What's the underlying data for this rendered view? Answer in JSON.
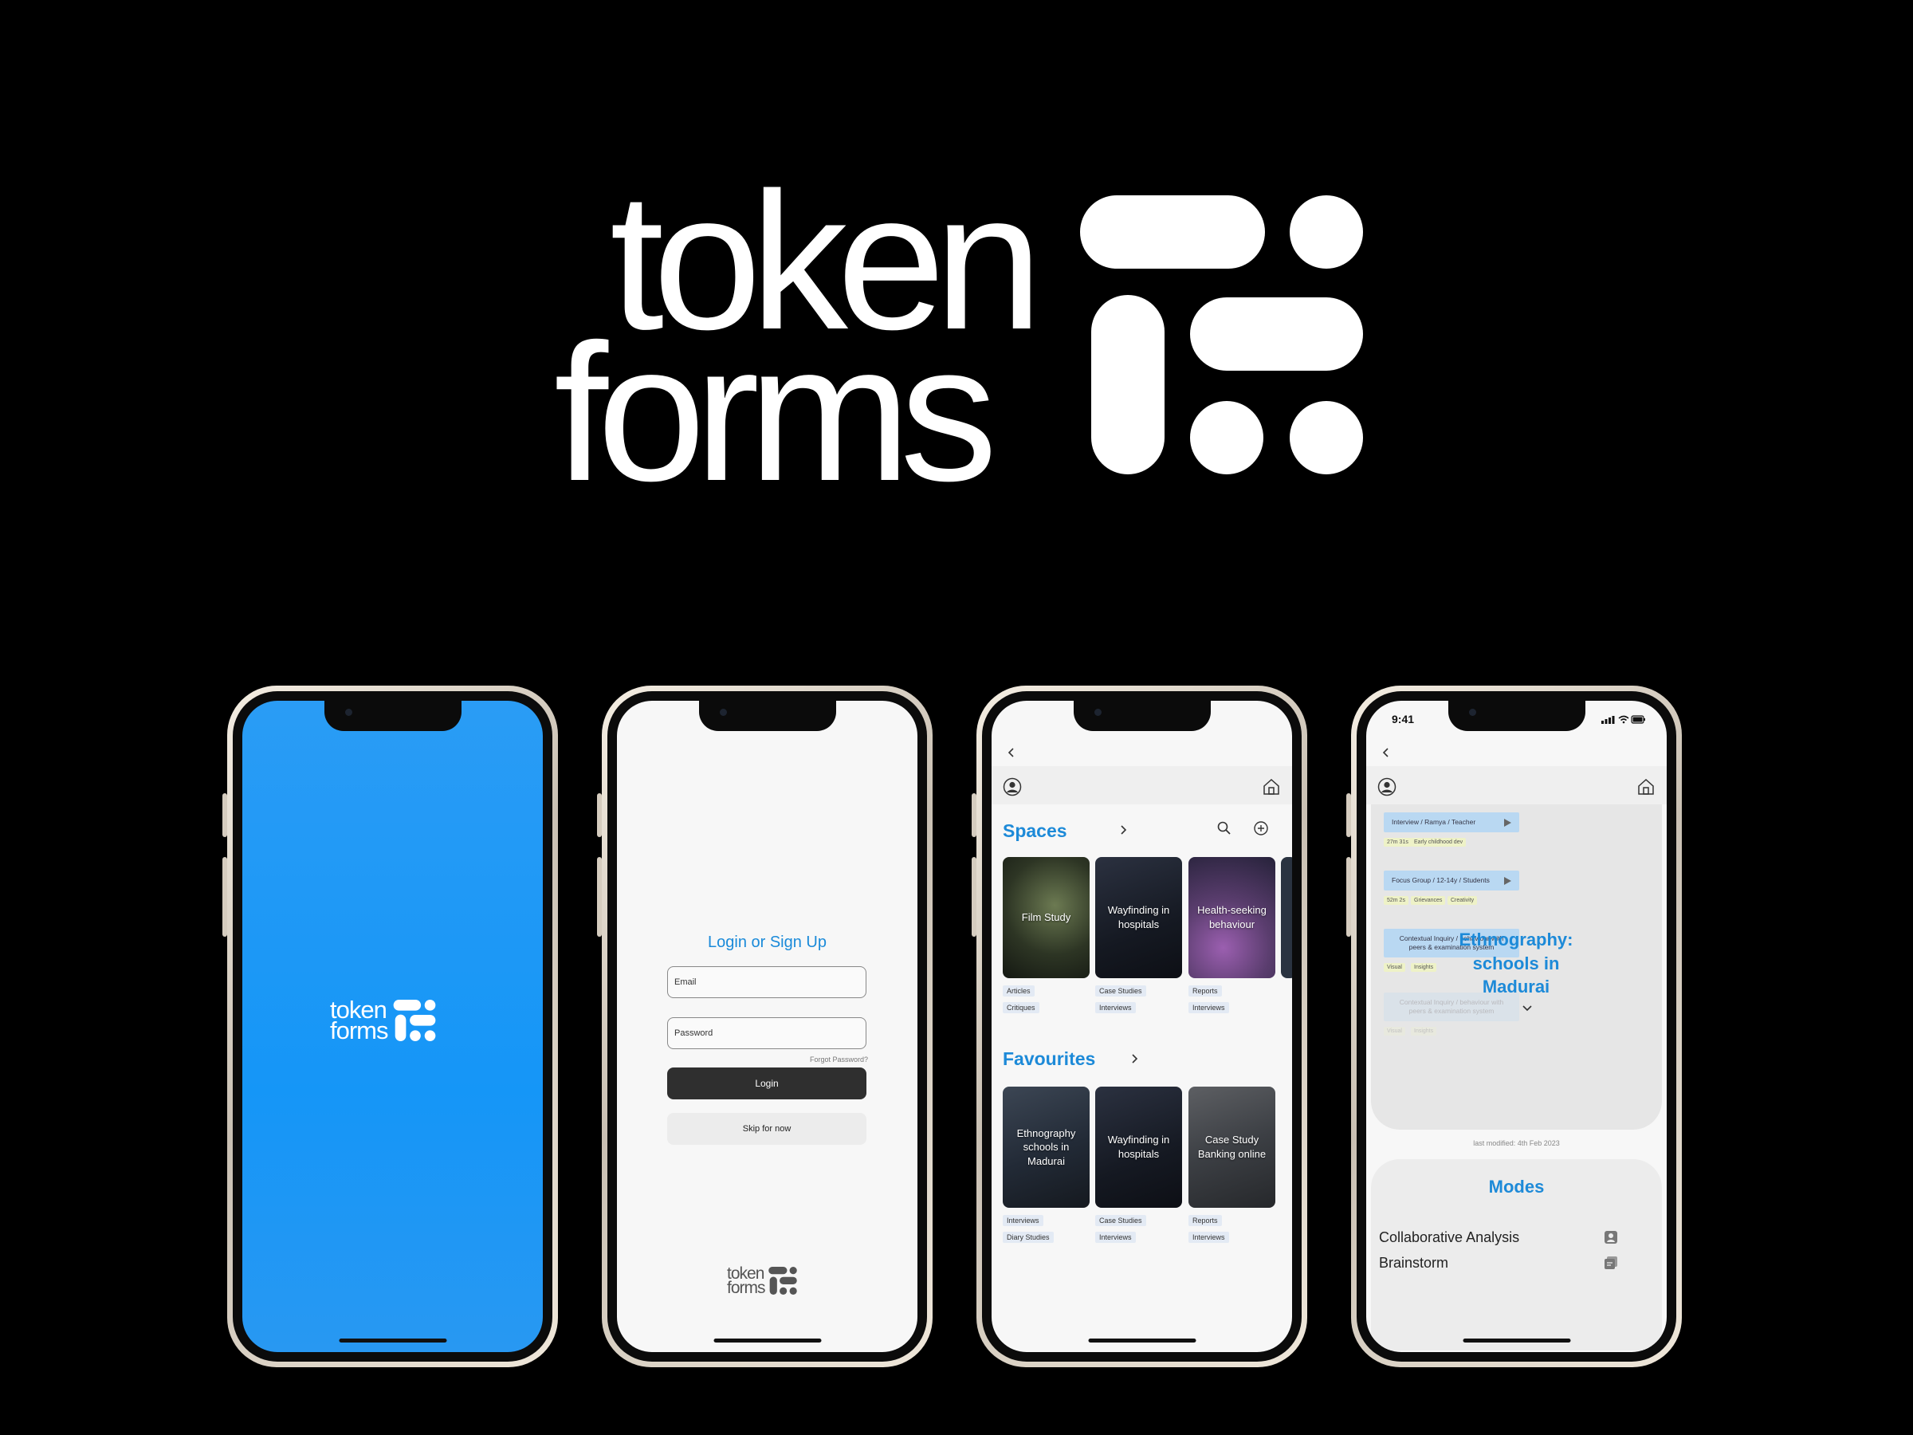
{
  "brand": {
    "word_top": "token",
    "word_bottom": "forms"
  },
  "login": {
    "title": "Login or Sign Up",
    "email_placeholder": "Email",
    "password_placeholder": "Password",
    "forgot": "Forgot Password?",
    "login_label": "Login",
    "skip_label": "Skip for now"
  },
  "spaces": {
    "title": "Spaces",
    "cards": [
      {
        "title": "Film Study",
        "tags": [
          "Articles",
          "Critiques"
        ]
      },
      {
        "title": "Wayfinding in hospitals",
        "tags": [
          "Case Studies",
          "Interviews"
        ]
      },
      {
        "title": "Health-seeking behaviour",
        "tags": [
          "Reports",
          "Interviews"
        ]
      }
    ]
  },
  "favourites": {
    "title": "Favourites",
    "cards": [
      {
        "title": "Ethnography schools in Madurai",
        "tags": [
          "Interviews",
          "Diary Studies"
        ]
      },
      {
        "title": "Wayfinding in hospitals",
        "tags": [
          "Case Studies",
          "Interviews"
        ]
      },
      {
        "title": "Case Study Banking online",
        "tags": [
          "Reports",
          "Interviews"
        ]
      }
    ]
  },
  "detail": {
    "status_time": "9:41",
    "recordings": [
      {
        "label": "Interview / Ramya / Teacher",
        "tags": [
          "27m 31s",
          "Early childhood dev"
        ]
      },
      {
        "label": "Focus Group / 12-14y / Students",
        "tags": [
          "52m 2s",
          "Grievances",
          "Creativity"
        ]
      },
      {
        "label": "Contextual Inquiry / behaviour with peers & examination system",
        "tags": [
          "Visual",
          "Insights"
        ]
      },
      {
        "label": "Contextual Inquiry / behaviour with peers & examination system",
        "tags": [
          "Visual",
          "Insights"
        ]
      }
    ],
    "title": "Ethnography: schools in Madurai",
    "modified": "last modified: 4th Feb 2023",
    "modes_title": "Modes",
    "modes": [
      "Collaborative Analysis",
      "Brainstorm"
    ]
  },
  "colors": {
    "accent": "#1d8ad8",
    "splash": "#1596f7",
    "button_dark": "#2f2f2f"
  },
  "icons": [
    "back-icon",
    "user-icon",
    "home-icon",
    "search-icon",
    "add-icon",
    "chevron-right-icon",
    "chevron-down-icon",
    "play-icon",
    "person-icon",
    "sticky-note-icon"
  ]
}
